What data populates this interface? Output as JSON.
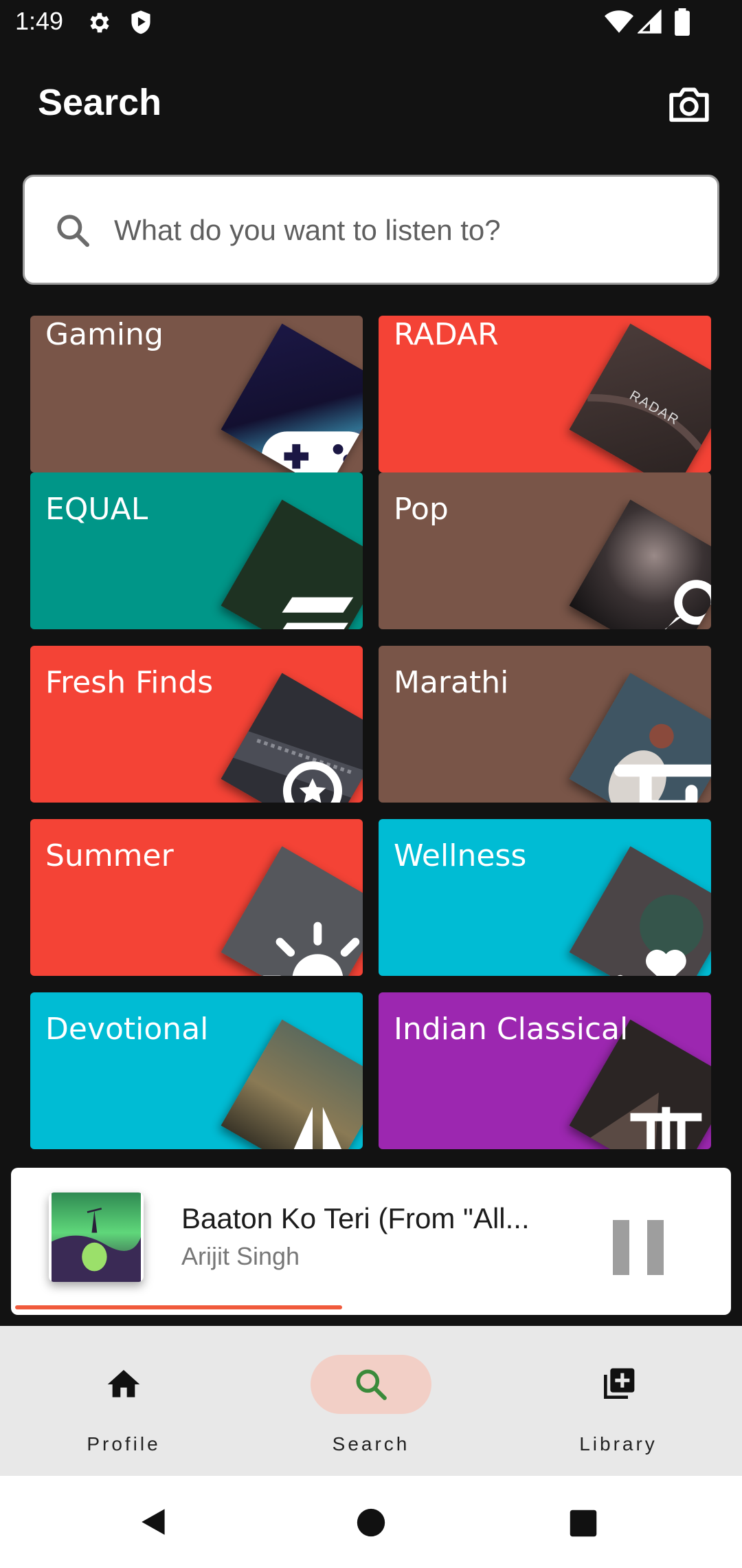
{
  "status_bar": {
    "time": "1:49",
    "icons": [
      "gear-icon",
      "shield-icon",
      "wifi-icon",
      "signal-icon",
      "battery-icon"
    ]
  },
  "header": {
    "title": "Search",
    "camera_icon": "camera-icon"
  },
  "search": {
    "placeholder": "What do you want to listen to?",
    "value": "",
    "icon": "search-icon"
  },
  "categories": [
    {
      "label": "Gaming",
      "color": "#795548",
      "art": "gamepad-icon"
    },
    {
      "label": "RADAR",
      "color": "#f44336",
      "art": "radar-wordmark",
      "art_text": "RADAR"
    },
    {
      "label": "EQUAL",
      "color": "#009688",
      "art": "equal-stripes-icon"
    },
    {
      "label": "Pop",
      "color": "#795548",
      "art": "microphone-icon"
    },
    {
      "label": "Fresh Finds",
      "color": "#f44336",
      "art": "magnifier-star-icon"
    },
    {
      "label": "Marathi",
      "color": "#795548",
      "art": "devanagari-letter-icon"
    },
    {
      "label": "Summer",
      "color": "#f44336",
      "art": "sun-icon"
    },
    {
      "label": "Wellness",
      "color": "#00bcd4",
      "art": "heart-hands-icon"
    },
    {
      "label": "Devotional",
      "color": "#00bcd4",
      "art": "praying-hands-icon"
    },
    {
      "label": "Indian Classical",
      "color": "#9c27b0",
      "art": "sitar-icon"
    }
  ],
  "now_playing": {
    "title": "Baaton Ko Teri (From \"All...",
    "artist": "Arijit Singh",
    "progress": 0.46,
    "progress_color": "#f05a3c",
    "control_icon": "pause-icon"
  },
  "bottom_nav": {
    "active": "Search",
    "active_color": "#f2cfc6",
    "items": [
      {
        "label": "Profile",
        "icon": "home-icon"
      },
      {
        "label": "Search",
        "icon": "search-icon"
      },
      {
        "label": "Library",
        "icon": "library-add-icon"
      }
    ]
  },
  "system_nav": {
    "icons": [
      "back-icon",
      "home-circle-icon",
      "recents-icon"
    ]
  }
}
